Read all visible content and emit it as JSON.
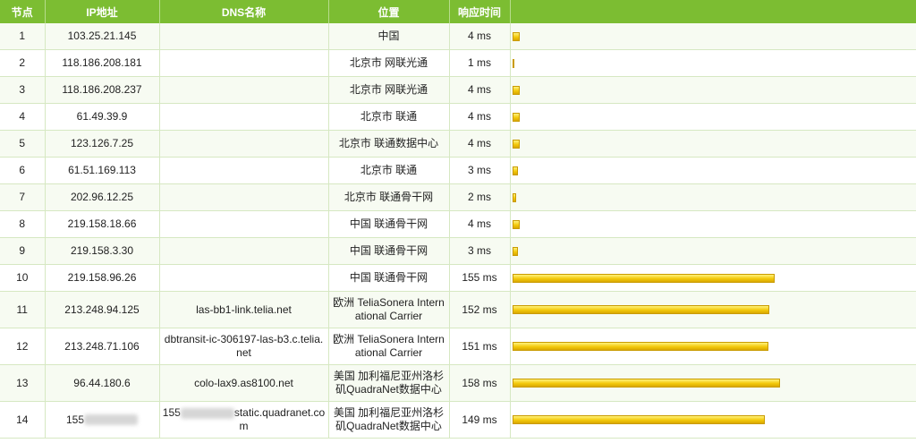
{
  "headers": {
    "node": "节点",
    "ip": "IP地址",
    "dns": "DNS名称",
    "location": "位置",
    "time": "响应时间"
  },
  "max_ms": 160,
  "bar_color": "#f3c90b",
  "header_color": "#7cbd32",
  "rows": [
    {
      "node": "1",
      "ip": "103.25.21.145",
      "dns": "",
      "location": "中国",
      "time": "4 ms",
      "ms": 4
    },
    {
      "node": "2",
      "ip": "118.186.208.181",
      "dns": "",
      "location": "北京市 网联光通",
      "time": "1 ms",
      "ms": 1
    },
    {
      "node": "3",
      "ip": "118.186.208.237",
      "dns": "",
      "location": "北京市 网联光通",
      "time": "4 ms",
      "ms": 4
    },
    {
      "node": "4",
      "ip": "61.49.39.9",
      "dns": "",
      "location": "北京市 联通",
      "time": "4 ms",
      "ms": 4
    },
    {
      "node": "5",
      "ip": "123.126.7.25",
      "dns": "",
      "location": "北京市 联通数据中心",
      "time": "4 ms",
      "ms": 4
    },
    {
      "node": "6",
      "ip": "61.51.169.113",
      "dns": "",
      "location": "北京市 联通",
      "time": "3 ms",
      "ms": 3
    },
    {
      "node": "7",
      "ip": "202.96.12.25",
      "dns": "",
      "location": "北京市 联通骨干网",
      "time": "2 ms",
      "ms": 2
    },
    {
      "node": "8",
      "ip": "219.158.18.66",
      "dns": "",
      "location": "中国 联通骨干网",
      "time": "4 ms",
      "ms": 4
    },
    {
      "node": "9",
      "ip": "219.158.3.30",
      "dns": "",
      "location": "中国 联通骨干网",
      "time": "3 ms",
      "ms": 3
    },
    {
      "node": "10",
      "ip": "219.158.96.26",
      "dns": "",
      "location": "中国 联通骨干网",
      "time": "155 ms",
      "ms": 155
    },
    {
      "node": "11",
      "ip": "213.248.94.125",
      "dns": "las-bb1-link.telia.net",
      "location": "欧洲 TeliaSonera International Carrier",
      "time": "152 ms",
      "ms": 152
    },
    {
      "node": "12",
      "ip": "213.248.71.106",
      "dns": "dbtransit-ic-306197-las-b3.c.telia.net",
      "location": "欧洲 TeliaSonera International Carrier",
      "time": "151 ms",
      "ms": 151
    },
    {
      "node": "13",
      "ip": "96.44.180.6",
      "dns": "colo-lax9.as8100.net",
      "location": "美国 加利福尼亚州洛杉矶QuadraNet数据中心",
      "time": "158 ms",
      "ms": 158
    },
    {
      "node": "14",
      "ip": "155",
      "dns_prefix": "155",
      "dns": "static.quadranet.com",
      "location": "美国 加利福尼亚州洛杉矶QuadraNet数据中心",
      "time": "149 ms",
      "ms": 149,
      "redacted": true
    }
  ]
}
